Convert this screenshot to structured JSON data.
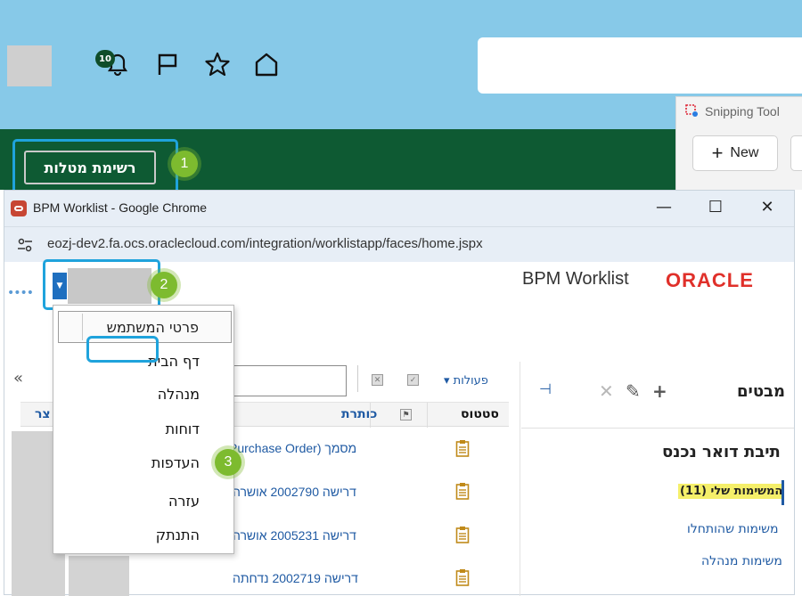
{
  "header": {
    "notification_count": "10",
    "icons": [
      "bell-icon",
      "flag-icon",
      "star-icon",
      "home-icon"
    ]
  },
  "snipping_tool": {
    "title": "Snipping Tool",
    "new_label": "New"
  },
  "green_bar": {
    "task_list_button": "רשימת מטלות"
  },
  "steps": [
    "1",
    "2",
    "3"
  ],
  "chrome_window": {
    "title": "BPM Worklist - Google Chrome",
    "url": "eozj-dev2.fa.ocs.oraclecloud.com/integration/worklistapp/faces/home.jspx",
    "minimize": "—",
    "maximize": "☐",
    "close": "✕"
  },
  "app": {
    "title": "BPM Worklist",
    "logo_text": "ORACLE",
    "dots": "••••"
  },
  "user_menu": {
    "items": [
      "פרטי המשתמש",
      "דף הבית",
      "מנהלה",
      "דוחות",
      "העדפות",
      "עזרה",
      "התנתק"
    ]
  },
  "toolbar": {
    "actions_label": "פעולות ▾",
    "collapse": "«"
  },
  "table": {
    "columns": {
      "title": "כותרת",
      "status": "סטטוס",
      "tsr": "צר"
    },
    "rows": [
      {
        "title": "מסמך (Purchase Order"
      },
      {
        "title": "דרישה 2002790 אושרה"
      },
      {
        "title": "דרישה 2005231 אושרה"
      },
      {
        "title": "דרישה 2002719 נדחתה"
      }
    ]
  },
  "right_panel": {
    "views_heading": "מבטים",
    "inbox_heading": "תיבת דואר נכנס",
    "links": {
      "my_tasks": "המשימות שלי (11)",
      "started": "משימות שהותחלו",
      "manager": "משימות מנהלה"
    }
  },
  "colors": {
    "header_bg": "#87c9e8",
    "green_bar": "#0e5a33",
    "highlight_frame": "#1fa3dc",
    "step_badge": "#7dbb2f",
    "link": "#1f5aa3",
    "oracle_red": "#e0302a",
    "my_tasks_highlight": "#f5ef6a"
  }
}
